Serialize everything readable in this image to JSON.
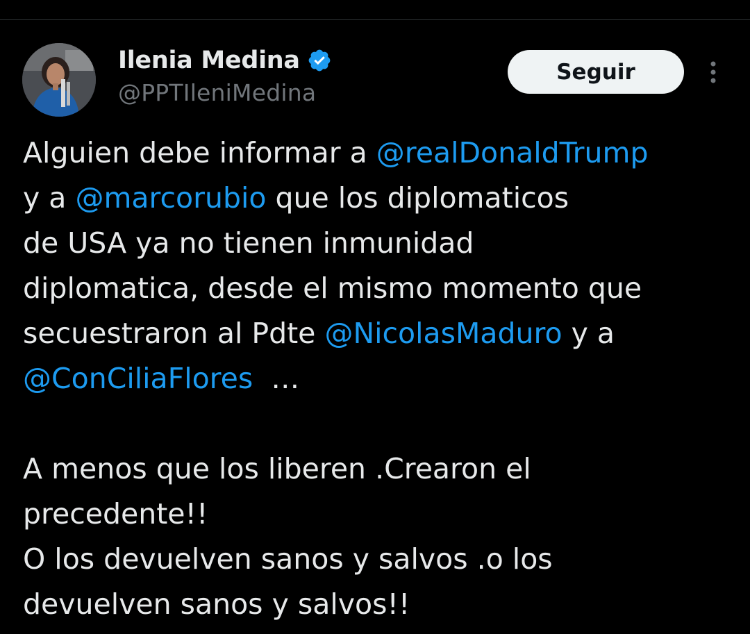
{
  "author": {
    "name": "Ilenia Medina",
    "handle": "@PPTIleniMedina",
    "verified": true,
    "verified_icon": "verified-badge-icon",
    "avatar_icon": "avatar-photo"
  },
  "actions": {
    "follow_label": "Seguir",
    "more_icon": "more-vertical-icon"
  },
  "colors": {
    "background": "#000000",
    "text": "#e7e9ea",
    "secondary": "#71767b",
    "mention": "#1d9bf0",
    "button_bg": "#eff3f4",
    "verified": "#1d9bf0"
  },
  "tweet": {
    "l1_a": "Alguien debe informar a ",
    "m1": "@realDonaldTrump",
    "l2_a": "y a ",
    "m2": "@marcorubio",
    "l2_b": " que los diplomaticos",
    "l3": "de USA ya no tienen inmunidad",
    "l4": "diplomatica, desde el mismo momento que",
    "l5_a": "secuestraron al Pdte ",
    "m3": "@NicolasMaduro",
    "l5_b": " y a",
    "m4": "@ConCiliaFlores",
    "l6_b": "  …",
    "l8": "A menos que los liberen .Crearon el",
    "l9": "precedente!!",
    "l10": "O los devuelven sanos y salvos .o los",
    "l11": "devuelven sanos y salvos!!"
  }
}
